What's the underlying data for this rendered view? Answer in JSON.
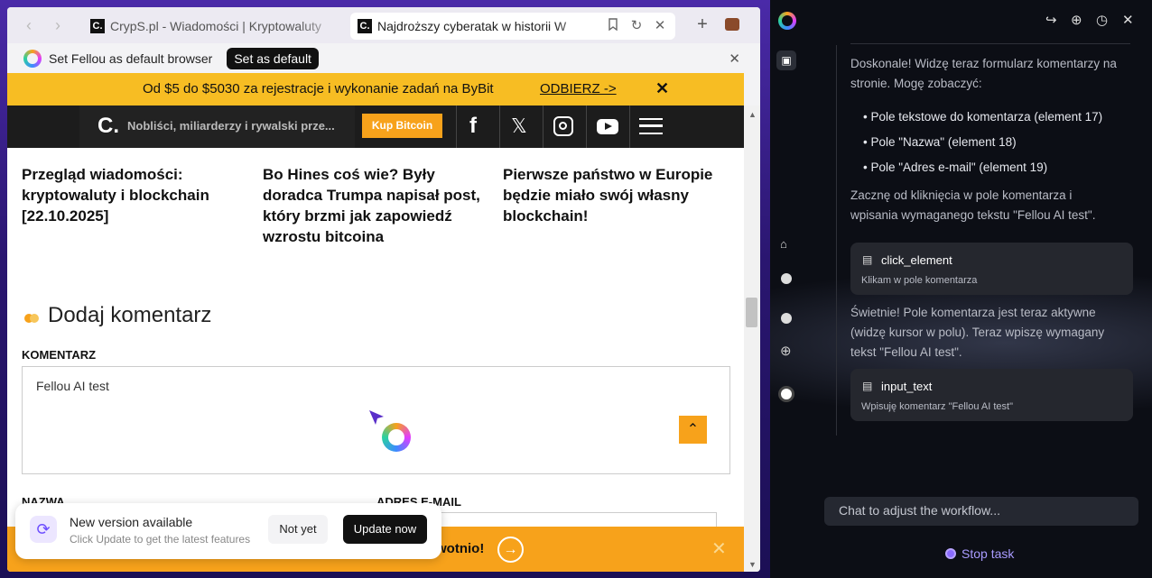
{
  "browser": {
    "tabs": [
      {
        "title": "CrypS.pl - Wiadomości | Kryptowaluty",
        "favicon": "C."
      },
      {
        "title": "Najdroższy cyberatak w historii W",
        "favicon": "C."
      }
    ],
    "default_bar": {
      "text": "Set Fellou as default browser",
      "button": "Set as default"
    }
  },
  "site": {
    "promo": {
      "text": "Od $5 do $5030 za rejestracje i wykonanie zadań na ByBit",
      "link": "ODBIERZ ->"
    },
    "header": {
      "logo": "C.",
      "ticker": "Nobliści, miliarderzy i rywalski prze...",
      "buy_button": "Kup Bitcoin"
    },
    "articles": [
      "Przegląd wiadomości: kryptowaluty i blockchain [22.10.2025]",
      "Bo Hines coś wie? Były doradca Trumpa napisał post, który brzmi jak zapowiedź wzrostu bitcoina",
      "Pierwsze państwo w Europie będzie miało swój własny blockchain!"
    ],
    "comment_section": {
      "title": "Dodaj komentarz",
      "comment_label": "KOMENTARZ",
      "comment_value": "Fellou AI test",
      "name_label": "NAZWA",
      "email_label": "ADRES E-MAIL"
    },
    "bottom_banner": {
      "text": "twotnio!"
    }
  },
  "update_toast": {
    "title": "New version available",
    "subtitle": "Click Update to get the latest features",
    "not_yet": "Not yet",
    "update_now": "Update now"
  },
  "assistant": {
    "intro": "Doskonale! Widzę teraz formularz komentarzy na stronie. Mogę zobaczyć:",
    "bullets": [
      "Pole tekstowe do komentarza (element 17)",
      "Pole \"Nazwa\" (element 18)",
      "Pole \"Adres e-mail\" (element 19)"
    ],
    "plan": "Zacznę od kliknięcia w pole komentarza i wpisania wymaganego tekstu \"Fellou AI test\".",
    "tool1": {
      "name": "click_element",
      "desc": "Klikam w pole komentarza"
    },
    "after1": "Świetnie! Pole komentarza jest teraz aktywne (widzę kursor w polu). Teraz wpiszę wymagany tekst \"Fellou AI test\".",
    "tool2": {
      "name": "input_text",
      "desc": "Wpisuję komentarz \"Fellou AI test\""
    },
    "chat_placeholder": "Chat to adjust the workflow...",
    "stop": "Stop task"
  },
  "colors": {
    "accent": "#f7a21b",
    "promo": "#f7bd23",
    "panel_bg": "#0c0e15",
    "frame": "#3b2396"
  }
}
